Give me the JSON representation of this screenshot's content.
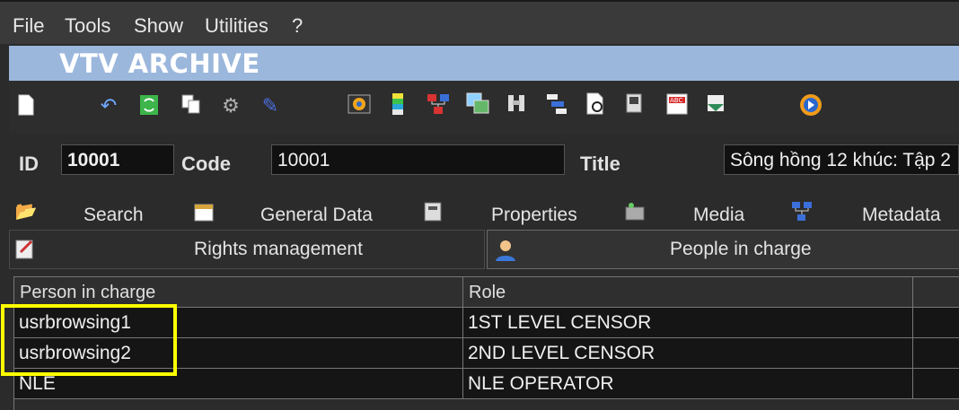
{
  "menu": [
    "File",
    "Tools",
    "Show",
    "Utilities",
    "?"
  ],
  "app_title": "VTV ARCHIVE",
  "toolbar_icons": [
    "new-document-icon",
    "undo-icon",
    "refresh-icon",
    "copy-icon",
    "tools-icon",
    "edit-icon",
    "film-icon",
    "color-bar-icon",
    "network-icon",
    "images-icon",
    "binoculars-icon",
    "list-icon",
    "preview-icon",
    "monitor-icon",
    "spellcheck-icon",
    "export-icon",
    "media-player-icon"
  ],
  "fields": {
    "id_label": "ID",
    "id_value": "10001",
    "code_label": "Code",
    "code_value": "10001",
    "title_label": "Title",
    "title_value": "Sông hồng 12 khúc: Tập 2"
  },
  "tabs_row1": [
    "Search",
    "General Data",
    "Properties",
    "Media",
    "Metadata"
  ],
  "tabs_row2": [
    "Rights management",
    "People in charge"
  ],
  "active_tab": "People in charge",
  "grid": {
    "columns": [
      "Person in charge",
      "Role"
    ],
    "rows": [
      {
        "person": "usrbrowsing1",
        "role": "1ST LEVEL CENSOR"
      },
      {
        "person": "usrbrowsing2",
        "role": "2ND LEVEL CENSOR"
      },
      {
        "person": "NLE",
        "role": "NLE OPERATOR"
      }
    ]
  },
  "colors": {
    "highlight": "#ffff00",
    "title_bar": "#9bb7dc"
  }
}
